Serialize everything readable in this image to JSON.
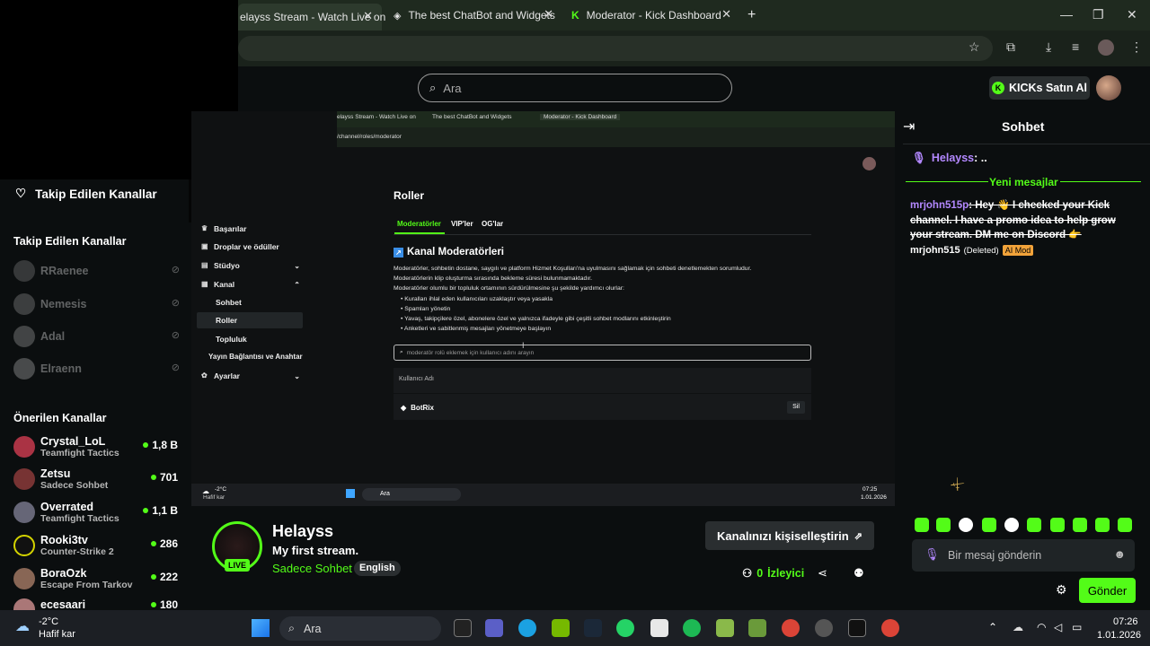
{
  "browser": {
    "tabs": [
      {
        "label": "elayss Stream - Watch Live on"
      },
      {
        "label": "The best ChatBot and Widgets"
      },
      {
        "label": "Moderator - Kick Dashboard"
      }
    ],
    "new_tab": "+"
  },
  "header": {
    "search_placeholder": "Ara",
    "kicks_button": "KICKs Satın Al"
  },
  "sidebar": {
    "followed_header": "Takip Edilen Kanallar",
    "followed_title": "Takip Edilen Kanallar",
    "followed": [
      {
        "name": "RRaenee"
      },
      {
        "name": "Nemesis"
      },
      {
        "name": "Adal"
      },
      {
        "name": "Elraenn"
      }
    ],
    "recommended_title": "Önerilen Kanallar",
    "recommended": [
      {
        "name": "Crystal_LoL",
        "category": "Teamfight Tactics",
        "viewers": "1,8 B"
      },
      {
        "name": "Zetsu",
        "category": "Sadece Sohbet",
        "viewers": "701"
      },
      {
        "name": "Overrated",
        "category": "Teamfight Tactics",
        "viewers": "1,1 B"
      },
      {
        "name": "Rooki3tv",
        "category": "Counter-Strike 2",
        "viewers": "286"
      },
      {
        "name": "BoraOzk",
        "category": "Escape From Tarkov",
        "viewers": "222"
      },
      {
        "name": "ecesaari",
        "category": "",
        "viewers": "180"
      }
    ]
  },
  "inner": {
    "tabs": [
      "elayss Stream - Watch Live on",
      "The best ChatBot and Widgets",
      "Moderator - Kick Dashboard"
    ],
    "url": "/channel/roles/moderator",
    "nav": [
      {
        "label": "Başarılar"
      },
      {
        "label": "Droplar ve ödüller"
      },
      {
        "label": "Stüdyo"
      },
      {
        "label": "Kanal"
      },
      {
        "label": "Sohbet"
      },
      {
        "label": "Roller"
      },
      {
        "label": "Topluluk"
      },
      {
        "label": "Yayın Bağlantısı ve Anahtar"
      },
      {
        "label": "Ayarlar"
      }
    ],
    "page_title": "Roller",
    "role_tabs": [
      "Moderatörler",
      "VIP'ler",
      "OG'lar"
    ],
    "section_title": "Kanal Moderatörleri",
    "desc1": "Moderatörler, sohbetin dostane, saygılı ve platform Hizmet Koşulları'na uyulmasını sağlamak için sohbeti denetlemekten sorumludur.",
    "desc2": "Moderatörlerin klip oluşturma sırasında bekleme süresi bulunmamaktadır.",
    "desc3": "Moderatörler olumlu bir topluluk ortamının sürdürülmesine şu şekilde yardımcı olurlar:",
    "bullets": [
      "Kuralları ihlal eden kullanıcıları uzaklaştır veya yasakla",
      "Spamları yönetin",
      "Yavaş, takipçilere özel, abonelere özel ve yalnızca ifadeyle gibi çeşitli sohbet modlarını etkinleştirin",
      "Anketleri ve sabitlenmiş mesajları yönetmeye başlayın"
    ],
    "search_placeholder": "moderatör rolü eklemek için kullanıcı adını arayın",
    "col_user": "Kullanıcı Adı",
    "mod_name": "BotRix",
    "delete": "Sil",
    "weather_temp": "-2°C",
    "weather_desc": "Hafif kar",
    "search": "Ara",
    "time": "07:25",
    "date": "1.01.2026"
  },
  "stream": {
    "streamer": "Helayss",
    "title": "My first stream.",
    "category": "Sadece Sohbet",
    "language": "English",
    "live": "LIVE",
    "customize": "Kanalınızı kişiselleştirin",
    "viewers": "0",
    "viewers_label": "İzleyici"
  },
  "chat": {
    "title": "Sohbet",
    "pinned_user": "Helayss",
    "pinned_text": ": ..",
    "new_messages": "Yeni mesajlar",
    "msg_user": "mrjohn515p",
    "msg_text": ": Hey 👋 I checked your Kick channel. I have a promo idea to help grow your stream. DM me on Discord 👉",
    "deleted_user": "mrjohn515",
    "deleted_label": "(Deleted)",
    "ai_mod": "AI Mod",
    "input_placeholder": "Bir mesaj gönderin",
    "send": "Gönder"
  },
  "taskbar": {
    "weather_temp": "-2°C",
    "weather_desc": "Hafif kar",
    "search": "Ara",
    "time": "07:26",
    "date": "1.01.2026"
  },
  "colors": {
    "accent": "#53fc18",
    "purple": "#b388ff",
    "bg": "#0b0e0f"
  }
}
